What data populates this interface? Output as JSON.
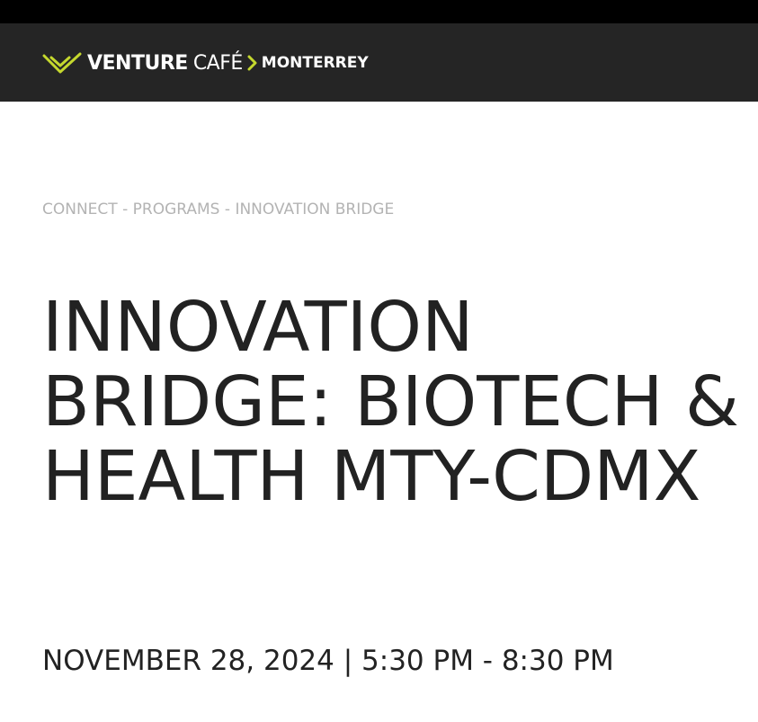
{
  "header": {
    "logo_venture": "VENTURE",
    "logo_cafe": "CAFÉ",
    "logo_city": "MONTERREY",
    "logo_accent": "#c5d82e",
    "background": "#252525"
  },
  "breadcrumb": {
    "items": [
      "CONNECT",
      "PROGRAMS",
      "INNOVATION BRIDGE"
    ],
    "separator": "-"
  },
  "event": {
    "title": "INNOVATION BRIDGE: BIOTECH & HEALTH MTY-CDMX",
    "date_time": "NOVEMBER 28, 2024 | 5:30 PM - 8:30 PM"
  }
}
